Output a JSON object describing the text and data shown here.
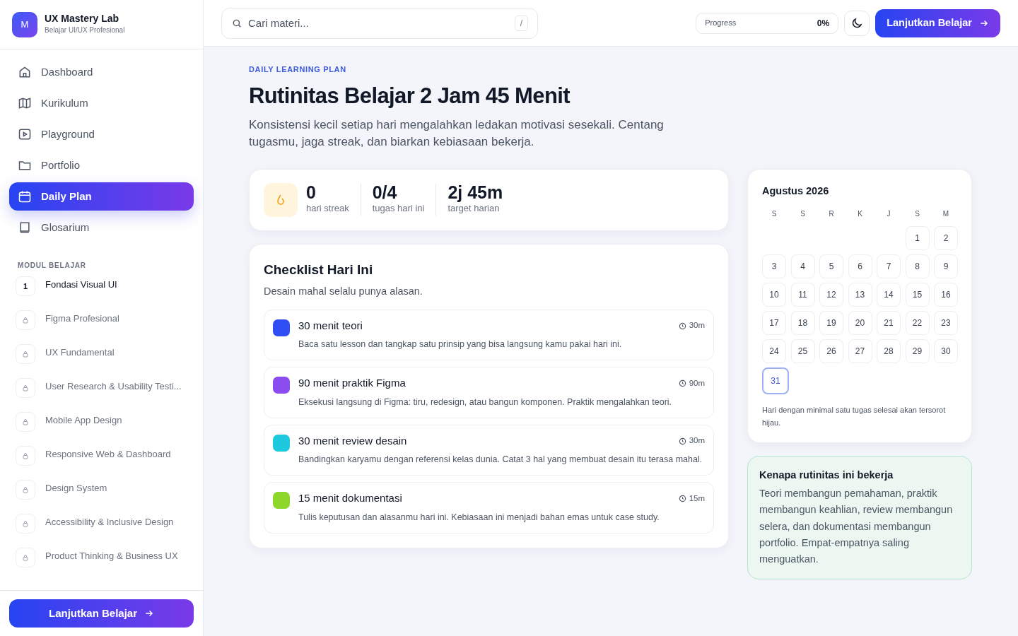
{
  "brand": {
    "name": "UX Mastery Lab",
    "tagline": "Belajar UI/UX Profesional",
    "logo": "M"
  },
  "nav": [
    {
      "label": "Dashboard",
      "kind": "home",
      "selected": false
    },
    {
      "label": "Kurikulum",
      "kind": "map",
      "selected": false
    },
    {
      "label": "Playground",
      "kind": "play",
      "selected": false
    },
    {
      "label": "Portfolio",
      "kind": "folder",
      "selected": false
    },
    {
      "label": "Daily Plan",
      "kind": "calendar",
      "selected": true
    },
    {
      "label": "Glosarium",
      "kind": "book",
      "selected": false
    }
  ],
  "modules_heading": "MODUL BELAJAR",
  "modules": [
    {
      "number": "1",
      "title": "Fondasi Visual UI",
      "locked": false
    },
    {
      "title": "Figma Profesional",
      "locked": true
    },
    {
      "title": "UX Fundamental",
      "locked": true
    },
    {
      "title": "User Research & Usability Testi...",
      "locked": true
    },
    {
      "title": "Mobile App Design",
      "locked": true
    },
    {
      "title": "Responsive Web & Dashboard",
      "locked": true
    },
    {
      "title": "Design System",
      "locked": true
    },
    {
      "title": "Accessibility & Inclusive Design",
      "locked": true
    },
    {
      "title": "Product Thinking & Business UX",
      "locked": true
    }
  ],
  "sidebar_button": "Lanjutkan Belajar",
  "search": {
    "placeholder": "Cari materi...",
    "shortcut": "/"
  },
  "progress": {
    "label": "Progress",
    "value": "0%"
  },
  "top_button": "Lanjutkan Belajar",
  "eyebrow": "DAILY LEARNING PLAN",
  "title": "Rutinitas Belajar 2 Jam 45 Menit",
  "subtitle": "Konsistensi kecil setiap hari mengalahkan ledakan motivasi sesekali. Centang tugasmu, jaga streak, dan biarkan kebiasaan bekerja.",
  "stats": [
    {
      "value": "0",
      "label": "hari streak"
    },
    {
      "value": "0/4",
      "label": "tugas hari ini"
    },
    {
      "value": "2j 45m",
      "label": "target harian"
    }
  ],
  "checklist": {
    "title": "Checklist Hari Ini",
    "subtitle": "Desain mahal selalu punya alasan.",
    "items": [
      {
        "title": "30 menit teori",
        "duration": "30m",
        "description": "Baca satu lesson dan tangkap satu prinsip yang bisa langsung kamu pakai hari ini.",
        "color": "#2f4ff5",
        "checked": false
      },
      {
        "title": "90 menit praktik Figma",
        "duration": "90m",
        "description": "Eksekusi langsung di Figma: tiru, redesign, atau bangun komponen. Praktik mengalahkan teori.",
        "color": "#8b4cf0",
        "checked": false
      },
      {
        "title": "30 menit review desain",
        "duration": "30m",
        "description": "Bandingkan karyamu dengan referensi kelas dunia. Catat 3 hal yang membuat desain itu terasa mahal.",
        "color": "#1ec8df",
        "checked": false
      },
      {
        "title": "15 menit dokumentasi",
        "duration": "15m",
        "description": "Tulis keputusan dan alasanmu hari ini. Kebiasaan ini menjadi bahan emas untuk case study.",
        "color": "#8ed629",
        "checked": false
      }
    ]
  },
  "calendar": {
    "month": "Agustus 2026",
    "weekdays": [
      "S",
      "S",
      "R",
      "K",
      "J",
      "S",
      "M"
    ],
    "days": [
      {
        "day": "1",
        "selected": false
      },
      {
        "day": "2",
        "selected": false
      },
      {
        "day": "3",
        "selected": false
      },
      {
        "day": "4",
        "selected": false
      },
      {
        "day": "5",
        "selected": false
      },
      {
        "day": "6",
        "selected": false
      },
      {
        "day": "7",
        "selected": false
      },
      {
        "day": "8",
        "selected": false
      },
      {
        "day": "9",
        "selected": false
      },
      {
        "day": "10",
        "selected": false
      },
      {
        "day": "11",
        "selected": false
      },
      {
        "day": "12",
        "selected": false
      },
      {
        "day": "13",
        "selected": false
      },
      {
        "day": "14",
        "selected": false
      },
      {
        "day": "15",
        "selected": false
      },
      {
        "day": "16",
        "selected": false
      },
      {
        "day": "17",
        "selected": false
      },
      {
        "day": "18",
        "selected": false
      },
      {
        "day": "19",
        "selected": false
      },
      {
        "day": "20",
        "selected": false
      },
      {
        "day": "21",
        "selected": false
      },
      {
        "day": "22",
        "selected": false
      },
      {
        "day": "23",
        "selected": false
      },
      {
        "day": "24",
        "selected": false
      },
      {
        "day": "25",
        "selected": false
      },
      {
        "day": "26",
        "selected": false
      },
      {
        "day": "27",
        "selected": false
      },
      {
        "day": "28",
        "selected": false
      },
      {
        "day": "29",
        "selected": false
      },
      {
        "day": "30",
        "selected": false
      },
      {
        "day": "31",
        "selected": true
      }
    ],
    "note": "Hari dengan minimal satu tugas selesai akan tersorot hijau."
  },
  "why": {
    "title": "Kenapa rutinitas ini bekerja",
    "text": "Teori membangun pemahaman, praktik membangun keahlian, review membangun selera, dan dokumentasi membangun portfolio. Empat-empatnya saling menguatkan."
  }
}
